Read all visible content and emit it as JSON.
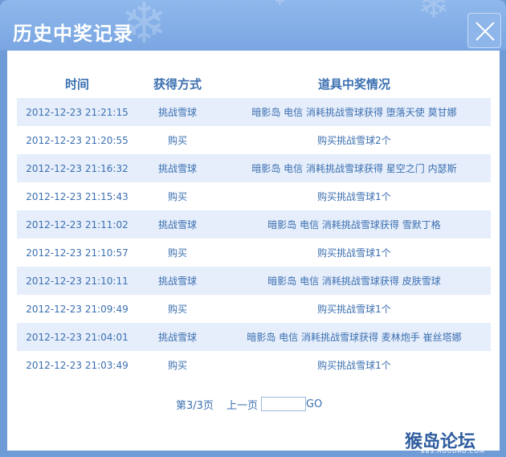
{
  "dialog": {
    "title": "历史中奖记录",
    "close_icon": "close-icon"
  },
  "table": {
    "headers": [
      "时间",
      "获得方式",
      "道具中奖情况"
    ],
    "rows": [
      {
        "time": "2012-12-23 21:21:15",
        "method": "挑战雪球",
        "detail": "暗影岛 电信 消耗挑战雪球获得 堕落天使 莫甘娜"
      },
      {
        "time": "2012-12-23 21:20:55",
        "method": "购买",
        "detail": "购买挑战雪球2个"
      },
      {
        "time": "2012-12-23 21:16:32",
        "method": "挑战雪球",
        "detail": "暗影岛 电信 消耗挑战雪球获得 星空之门 内瑟斯"
      },
      {
        "time": "2012-12-23 21:15:43",
        "method": "购买",
        "detail": "购买挑战雪球1个"
      },
      {
        "time": "2012-12-23 21:11:02",
        "method": "挑战雪球",
        "detail": "暗影岛 电信 消耗挑战雪球获得 雪默丁格"
      },
      {
        "time": "2012-12-23 21:10:57",
        "method": "购买",
        "detail": "购买挑战雪球1个"
      },
      {
        "time": "2012-12-23 21:10:11",
        "method": "挑战雪球",
        "detail": "暗影岛 电信 消耗挑战雪球获得 皮肤雪球"
      },
      {
        "time": "2012-12-23 21:09:49",
        "method": "购买",
        "detail": "购买挑战雪球1个"
      },
      {
        "time": "2012-12-23 21:04:01",
        "method": "挑战雪球",
        "detail": "暗影岛 电信 消耗挑战雪球获得 麦林炮手 崔丝塔娜"
      },
      {
        "time": "2012-12-23 21:03:49",
        "method": "购买",
        "detail": "购买挑战雪球1个"
      }
    ]
  },
  "pager": {
    "page_info": "第3/3页",
    "prev_label": "上一页",
    "page_input_value": "",
    "go_label": "GO"
  },
  "watermark": {
    "brand": "猴岛论坛",
    "url": "BBS.HOUDAO.COM"
  },
  "colors": {
    "accent": "#3b6fb0",
    "row_alt": "#e6eefb",
    "frame": "#6f9bd6"
  }
}
